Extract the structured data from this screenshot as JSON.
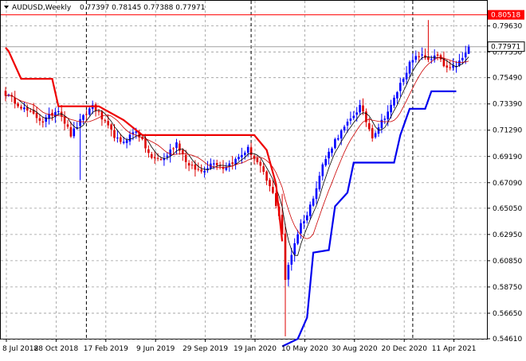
{
  "header": {
    "symbol": "AUDUSD,Weekly",
    "ohlc": "0.77397 0.78145 0.77388 0.77971"
  },
  "chart_data": {
    "type": "candlestick",
    "symbol": "AUDUSD",
    "timeframe": "Weekly",
    "last_ohlc": {
      "open": 0.77397,
      "high": 0.78145,
      "low": 0.77388,
      "close": 0.77971
    },
    "ylim": [
      0.5461,
      0.8164
    ],
    "y_ticks": [
      "0.79630",
      "0.77550",
      "0.75490",
      "0.73390",
      "0.71290",
      "0.69190",
      "0.67090",
      "0.65050",
      "0.62950",
      "0.60850",
      "0.58750",
      "0.56650",
      "0.54610"
    ],
    "x_ticks": [
      "8 Jul 2018",
      "28 Oct 2018",
      "17 Feb 2019",
      "9 Jun 2019",
      "29 Sep 2019",
      "19 Jan 2020",
      "10 May 2020",
      "30 Aug 2020",
      "20 Dec 2020",
      "11 Apr 2021"
    ],
    "red_level": {
      "value": 0.80518,
      "label": "0.80518",
      "color": "#ff0000"
    },
    "current_price": {
      "value": 0.77971,
      "label": "0.77971"
    },
    "grid": true,
    "colors": {
      "bull": "#0000ff",
      "bear": "#dd0000",
      "trail_red": "#ee0000",
      "trail_blue": "#0000ee",
      "ma_fast": "#000000",
      "ma_slow": "#cc0000"
    },
    "anchors": [
      [
        0,
        0.742,
        "d"
      ],
      [
        6,
        0.73,
        "d"
      ],
      [
        12,
        0.72,
        "d"
      ],
      [
        17,
        0.73,
        "u"
      ],
      [
        21,
        0.709,
        "d"
      ],
      [
        24,
        0.72,
        "u"
      ],
      [
        28,
        0.733,
        "u"
      ],
      [
        33,
        0.715,
        "d"
      ],
      [
        37,
        0.702,
        "d"
      ],
      [
        42,
        0.713,
        "u"
      ],
      [
        47,
        0.69,
        "d"
      ],
      [
        51,
        0.69,
        "f"
      ],
      [
        55,
        0.703,
        "u"
      ],
      [
        59,
        0.684,
        "d"
      ],
      [
        63,
        0.68,
        "d"
      ],
      [
        67,
        0.688,
        "u"
      ],
      [
        70,
        0.683,
        "d"
      ],
      [
        74,
        0.689,
        "u"
      ],
      [
        78,
        0.698,
        "u"
      ],
      [
        82,
        0.683,
        "d"
      ],
      [
        86,
        0.662,
        "d"
      ],
      [
        88,
        0.645,
        "d"
      ],
      [
        89,
        0.63,
        "d"
      ],
      [
        90,
        0.592,
        "d"
      ],
      [
        91,
        0.605,
        "u"
      ],
      [
        93,
        0.623,
        "u"
      ],
      [
        95,
        0.638,
        "u"
      ],
      [
        97,
        0.645,
        "u"
      ],
      [
        99,
        0.66,
        "u"
      ],
      [
        102,
        0.685,
        "u"
      ],
      [
        106,
        0.705,
        "u"
      ],
      [
        110,
        0.718,
        "u"
      ],
      [
        114,
        0.732,
        "u"
      ],
      [
        116,
        0.72,
        "d"
      ],
      [
        118,
        0.708,
        "d"
      ],
      [
        121,
        0.72,
        "u"
      ],
      [
        124,
        0.732,
        "u"
      ],
      [
        127,
        0.75,
        "u"
      ],
      [
        130,
        0.766,
        "u"
      ],
      [
        133,
        0.773,
        "u"
      ],
      [
        136,
        0.77,
        "d"
      ],
      [
        139,
        0.772,
        "u"
      ],
      [
        141,
        0.764,
        "d"
      ],
      [
        143,
        0.761,
        "d"
      ],
      [
        145,
        0.765,
        "u"
      ],
      [
        147,
        0.77,
        "u"
      ],
      [
        149,
        0.7797,
        "u"
      ]
    ],
    "trail_red": [
      [
        0,
        0.779
      ],
      [
        1,
        0.776
      ],
      [
        5,
        0.754
      ],
      [
        15,
        0.754
      ],
      [
        17,
        0.732
      ],
      [
        30,
        0.732
      ],
      [
        38,
        0.721
      ],
      [
        44,
        0.709
      ],
      [
        80,
        0.709
      ],
      [
        84,
        0.697
      ],
      [
        87,
        0.67
      ],
      [
        89,
        0.624
      ]
    ],
    "trail_blue": [
      [
        89,
        0.54
      ],
      [
        94,
        0.546
      ],
      [
        97,
        0.563
      ],
      [
        99,
        0.615
      ],
      [
        104,
        0.617
      ],
      [
        106,
        0.652
      ],
      [
        110,
        0.663
      ],
      [
        112,
        0.687
      ],
      [
        125,
        0.687
      ],
      [
        127,
        0.709
      ],
      [
        130,
        0.73
      ],
      [
        135,
        0.73
      ],
      [
        137,
        0.744
      ],
      [
        145,
        0.744
      ]
    ],
    "specials": [
      {
        "i": 24,
        "low": 0.673
      },
      {
        "i": 90,
        "low": 0.548,
        "high": 0.638
      },
      {
        "i": 89,
        "high": 0.662
      },
      {
        "i": 136,
        "high": 0.801
      }
    ],
    "bars": 150
  }
}
